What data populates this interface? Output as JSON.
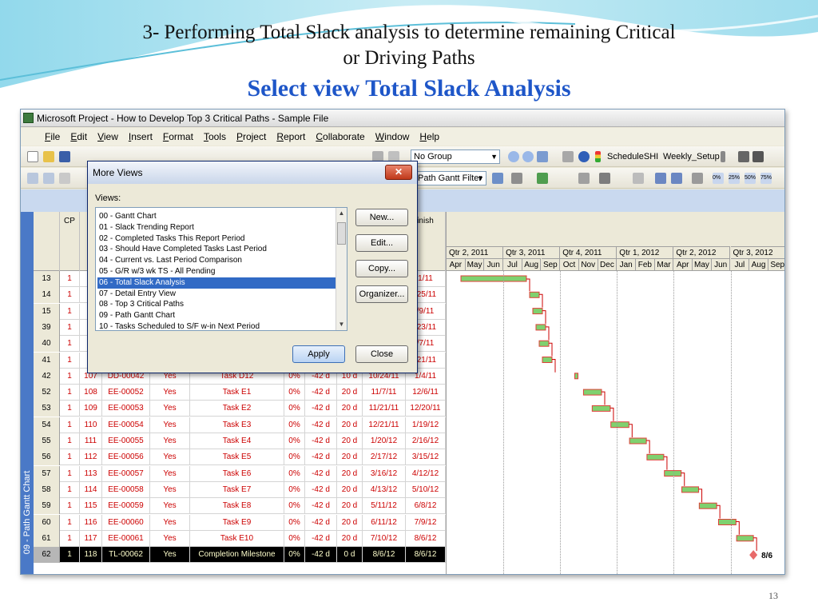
{
  "slide": {
    "title_line1": "3- Performing Total Slack analysis to determine remaining Critical",
    "title_line2": "or Driving Paths",
    "subtitle": "Select view Total Slack Analysis",
    "page_number": "13"
  },
  "window": {
    "title": "Microsoft Project - How to Develop Top 3 Critical Paths - Sample File"
  },
  "menu": [
    "File",
    "Edit",
    "View",
    "Insert",
    "Format",
    "Tools",
    "Project",
    "Report",
    "Collaborate",
    "Window",
    "Help"
  ],
  "toolbar": {
    "group_value": "No Group",
    "toolbar_name": "ScheduleSHI",
    "setup_name": "Weekly_Setup",
    "filter_value": "Path Gantt Filter",
    "pct_labels": [
      "0%",
      "25%",
      "50%",
      "75%"
    ]
  },
  "view_bar": {
    "label": "09 - Path Gantt Chart"
  },
  "table": {
    "headers": {
      "cp": "CP",
      "finish": "inish"
    },
    "rows": [
      {
        "id": "13",
        "cp": "1",
        "num": "",
        "code": "",
        "crit": "",
        "task": "",
        "pct": "",
        "slack": "",
        "dur": "",
        "start": "",
        "finish": "1/11"
      },
      {
        "id": "14",
        "cp": "1",
        "num": "",
        "code": "",
        "crit": "",
        "task": "",
        "pct": "",
        "slack": "",
        "dur": "",
        "start": "",
        "finish": "/25/11"
      },
      {
        "id": "15",
        "cp": "1",
        "num": "",
        "code": "",
        "crit": "",
        "task": "",
        "pct": "",
        "slack": "",
        "dur": "",
        "start": "",
        "finish": "/9/11"
      },
      {
        "id": "39",
        "cp": "1",
        "num": "",
        "code": "",
        "crit": "",
        "task": "",
        "pct": "",
        "slack": "",
        "dur": "",
        "start": "",
        "finish": "/23/11"
      },
      {
        "id": "40",
        "cp": "1",
        "num": "",
        "code": "",
        "crit": "",
        "task": "",
        "pct": "",
        "slack": "",
        "dur": "",
        "start": "",
        "finish": "/7/11"
      },
      {
        "id": "41",
        "cp": "1",
        "num": "",
        "code": "",
        "crit": "",
        "task": "",
        "pct": "",
        "slack": "",
        "dur": "",
        "start": "",
        "finish": "/21/11"
      },
      {
        "id": "42",
        "cp": "1",
        "num": "107",
        "code": "DD-00042",
        "crit": "Yes",
        "task": "Task D12",
        "pct": "0%",
        "slack": "-42 d",
        "dur": "10 d",
        "start": "10/24/11",
        "finish": "1/4/11"
      },
      {
        "id": "52",
        "cp": "1",
        "num": "108",
        "code": "EE-00052",
        "crit": "Yes",
        "task": "Task E1",
        "pct": "0%",
        "slack": "-42 d",
        "dur": "20 d",
        "start": "11/7/11",
        "finish": "12/6/11"
      },
      {
        "id": "53",
        "cp": "1",
        "num": "109",
        "code": "EE-00053",
        "crit": "Yes",
        "task": "Task E2",
        "pct": "0%",
        "slack": "-42 d",
        "dur": "20 d",
        "start": "11/21/11",
        "finish": "12/20/11"
      },
      {
        "id": "54",
        "cp": "1",
        "num": "110",
        "code": "EE-00054",
        "crit": "Yes",
        "task": "Task E3",
        "pct": "0%",
        "slack": "-42 d",
        "dur": "20 d",
        "start": "12/21/11",
        "finish": "1/19/12"
      },
      {
        "id": "55",
        "cp": "1",
        "num": "111",
        "code": "EE-00055",
        "crit": "Yes",
        "task": "Task E4",
        "pct": "0%",
        "slack": "-42 d",
        "dur": "20 d",
        "start": "1/20/12",
        "finish": "2/16/12"
      },
      {
        "id": "56",
        "cp": "1",
        "num": "112",
        "code": "EE-00056",
        "crit": "Yes",
        "task": "Task E5",
        "pct": "0%",
        "slack": "-42 d",
        "dur": "20 d",
        "start": "2/17/12",
        "finish": "3/15/12"
      },
      {
        "id": "57",
        "cp": "1",
        "num": "113",
        "code": "EE-00057",
        "crit": "Yes",
        "task": "Task E6",
        "pct": "0%",
        "slack": "-42 d",
        "dur": "20 d",
        "start": "3/16/12",
        "finish": "4/12/12"
      },
      {
        "id": "58",
        "cp": "1",
        "num": "114",
        "code": "EE-00058",
        "crit": "Yes",
        "task": "Task E7",
        "pct": "0%",
        "slack": "-42 d",
        "dur": "20 d",
        "start": "4/13/12",
        "finish": "5/10/12"
      },
      {
        "id": "59",
        "cp": "1",
        "num": "115",
        "code": "EE-00059",
        "crit": "Yes",
        "task": "Task E8",
        "pct": "0%",
        "slack": "-42 d",
        "dur": "20 d",
        "start": "5/11/12",
        "finish": "6/8/12"
      },
      {
        "id": "60",
        "cp": "1",
        "num": "116",
        "code": "EE-00060",
        "crit": "Yes",
        "task": "Task E9",
        "pct": "0%",
        "slack": "-42 d",
        "dur": "20 d",
        "start": "6/11/12",
        "finish": "7/9/12"
      },
      {
        "id": "61",
        "cp": "1",
        "num": "117",
        "code": "EE-00061",
        "crit": "Yes",
        "task": "Task E10",
        "pct": "0%",
        "slack": "-42 d",
        "dur": "20 d",
        "start": "7/10/12",
        "finish": "8/6/12"
      },
      {
        "id": "62",
        "cp": "1",
        "num": "118",
        "code": "TL-00062",
        "crit": "Yes",
        "task": "Completion Milestone",
        "pct": "0%",
        "slack": "-42 d",
        "dur": "0 d",
        "start": "8/6/12",
        "finish": "8/6/12",
        "highlight": true
      }
    ]
  },
  "gantt": {
    "quarters": [
      "Qtr 2, 2011",
      "Qtr 3, 2011",
      "Qtr 4, 2011",
      "Qtr 1, 2012",
      "Qtr 2, 2012",
      "Qtr 3, 2012"
    ],
    "months": [
      "Apr",
      "May",
      "Jun",
      "Jul",
      "Aug",
      "Sep",
      "Oct",
      "Nov",
      "Dec",
      "Jan",
      "Feb",
      "Mar",
      "Apr",
      "May",
      "Jun",
      "Jul",
      "Aug",
      "Sep"
    ],
    "milestone_label": "8/6",
    "colors": {
      "bar_fill": "#7fd16f",
      "bar_top": "#e0403a",
      "arrow": "#cc0000",
      "milestone": "#e86a6a"
    }
  },
  "dialog": {
    "title": "More Views",
    "list_label": "Views:",
    "items": [
      "00 - Gantt Chart",
      "01 - Slack Trending Report",
      "02 - Completed Tasks This Report Period",
      "03 - Should Have Completed Tasks Last Period",
      "04 - Current vs. Last Period Comparison",
      "05 - G/R w/3 wk TS - All Pending",
      "06 - Total Slack Analysis",
      "07 - Detail Entry View",
      "08 - Top 3 Critical Paths",
      "09 - Path Gantt Chart",
      "10 - Tasks Scheduled to S/F w-in Next Period"
    ],
    "selected_index": 6,
    "buttons": {
      "new": "New...",
      "edit": "Edit...",
      "copy": "Copy...",
      "organizer": "Organizer...",
      "apply": "Apply",
      "close": "Close"
    },
    "close_glyph": "✕"
  }
}
